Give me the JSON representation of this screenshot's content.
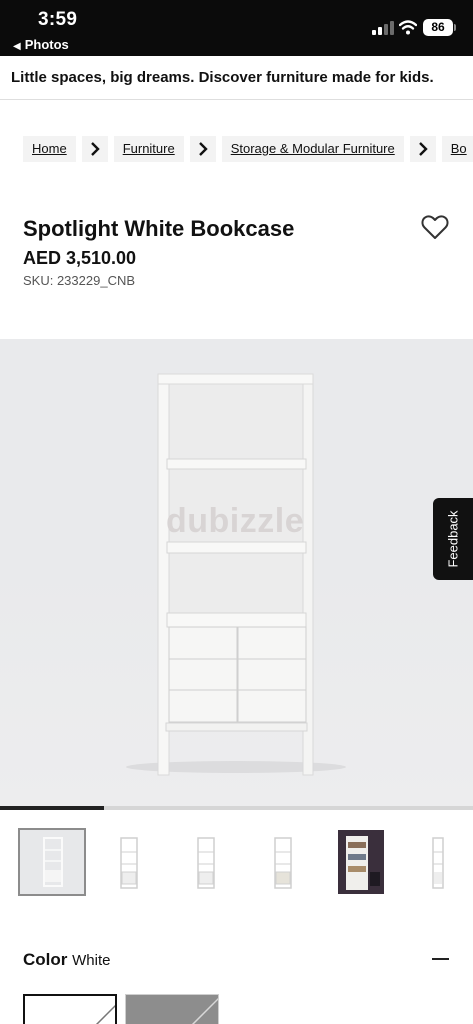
{
  "status_bar": {
    "time": "3:59",
    "back_label": "Photos",
    "battery": "86"
  },
  "promo": "Little spaces, big dreams. Discover furniture made for kids.",
  "breadcrumb": [
    "Home",
    "Furniture",
    "Storage & Modular Furniture",
    "Bo"
  ],
  "product": {
    "title": "Spotlight White Bookcase",
    "price": "AED 3,510.00",
    "sku": "SKU: 233229_CNB"
  },
  "image": {
    "watermark": "dubizzle",
    "progress": 0.22
  },
  "feedback_label": "Feedback",
  "color": {
    "label": "Color",
    "value": "White"
  },
  "swatches": [
    "white",
    "grey"
  ]
}
